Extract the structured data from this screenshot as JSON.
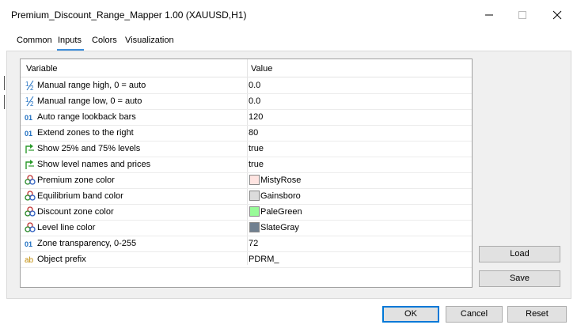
{
  "window": {
    "title": "Premium_Discount_Range_Mapper 1.00 (XAUUSD,H1)"
  },
  "tabs": [
    {
      "label": "Common"
    },
    {
      "label": "Inputs",
      "active": true
    },
    {
      "label": "Colors"
    },
    {
      "label": "Visualization"
    }
  ],
  "table": {
    "headers": {
      "variable": "Variable",
      "value": "Value"
    },
    "rows": [
      {
        "icon": "fraction-icon",
        "name": "Manual range high, 0 = auto",
        "value": "0.0"
      },
      {
        "icon": "fraction-icon",
        "name": "Manual range low, 0 = auto",
        "value": "0.0"
      },
      {
        "icon": "integer-icon",
        "name": "Auto range lookback bars",
        "value": "120"
      },
      {
        "icon": "integer-icon",
        "name": "Extend zones to the right",
        "value": "80"
      },
      {
        "icon": "bool-arrow-icon",
        "name": "Show 25% and 75% levels",
        "value": "true"
      },
      {
        "icon": "bool-arrow-icon",
        "name": "Show level names and prices",
        "value": "true"
      },
      {
        "icon": "color-palette-icon",
        "name": "Premium zone color",
        "value": "MistyRose",
        "swatch": "#ffe4e1"
      },
      {
        "icon": "color-palette-icon",
        "name": "Equilibrium band color",
        "value": "Gainsboro",
        "swatch": "#dcdcdc"
      },
      {
        "icon": "color-palette-icon",
        "name": "Discount zone color",
        "value": "PaleGreen",
        "swatch": "#98fb98"
      },
      {
        "icon": "color-palette-icon",
        "name": "Level line color",
        "value": "SlateGray",
        "swatch": "#708090"
      },
      {
        "icon": "integer-icon",
        "name": "Zone transparency, 0-255",
        "value": "72"
      },
      {
        "icon": "string-icon",
        "name": "Object prefix",
        "value": "PDRM_"
      }
    ]
  },
  "side_buttons": {
    "load": "Load",
    "save": "Save"
  },
  "footer_buttons": {
    "ok": "OK",
    "cancel": "Cancel",
    "reset": "Reset"
  },
  "colors": {
    "accent": "#0078d7",
    "tab_underline": "#3c8edc"
  }
}
